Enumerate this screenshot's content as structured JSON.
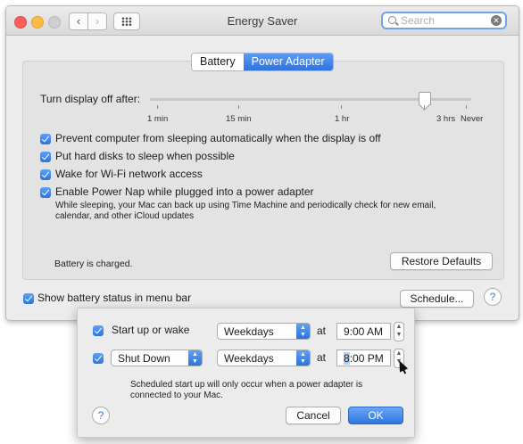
{
  "window": {
    "title": "Energy Saver",
    "search_placeholder": "Search"
  },
  "tabs": [
    {
      "label": "Battery",
      "selected": false
    },
    {
      "label": "Power Adapter",
      "selected": true
    }
  ],
  "slider": {
    "label": "Turn display off after:",
    "tick_labels": [
      "1 min",
      "15 min",
      "1 hr",
      "3 hrs",
      "Never"
    ],
    "selected_tick": "3 hrs"
  },
  "options": [
    {
      "label": "Prevent computer from sleeping automatically when the display is off",
      "checked": true
    },
    {
      "label": "Put hard disks to sleep when possible",
      "checked": true
    },
    {
      "label": "Wake for Wi-Fi network access",
      "checked": true
    },
    {
      "label": "Enable Power Nap while plugged into a power adapter",
      "checked": true
    }
  ],
  "power_nap_note_line1": "While sleeping, your Mac can back up using Time Machine and periodically check for new email,",
  "power_nap_note_line2": "calendar, and other iCloud updates",
  "battery_status": "Battery is charged.",
  "restore_defaults": "Restore Defaults",
  "show_battery_status": {
    "label": "Show battery status in menu bar",
    "checked": true
  },
  "schedule_button": "Schedule...",
  "help_label": "?",
  "schedule_sheet": {
    "row1": {
      "checked": true,
      "label": "Start up or wake",
      "days": "Weekdays",
      "at": "at",
      "time": "9:00 AM"
    },
    "row2": {
      "checked": true,
      "action": "Shut Down",
      "days": "Weekdays",
      "at": "at",
      "time_hour": "8",
      "time_rest": ":00 PM"
    },
    "note_line1": "Scheduled start up will only occur when a power adapter is",
    "note_line2": "connected to your Mac.",
    "cancel": "Cancel",
    "ok": "OK"
  },
  "colors": {
    "accent": "#2f74de"
  }
}
